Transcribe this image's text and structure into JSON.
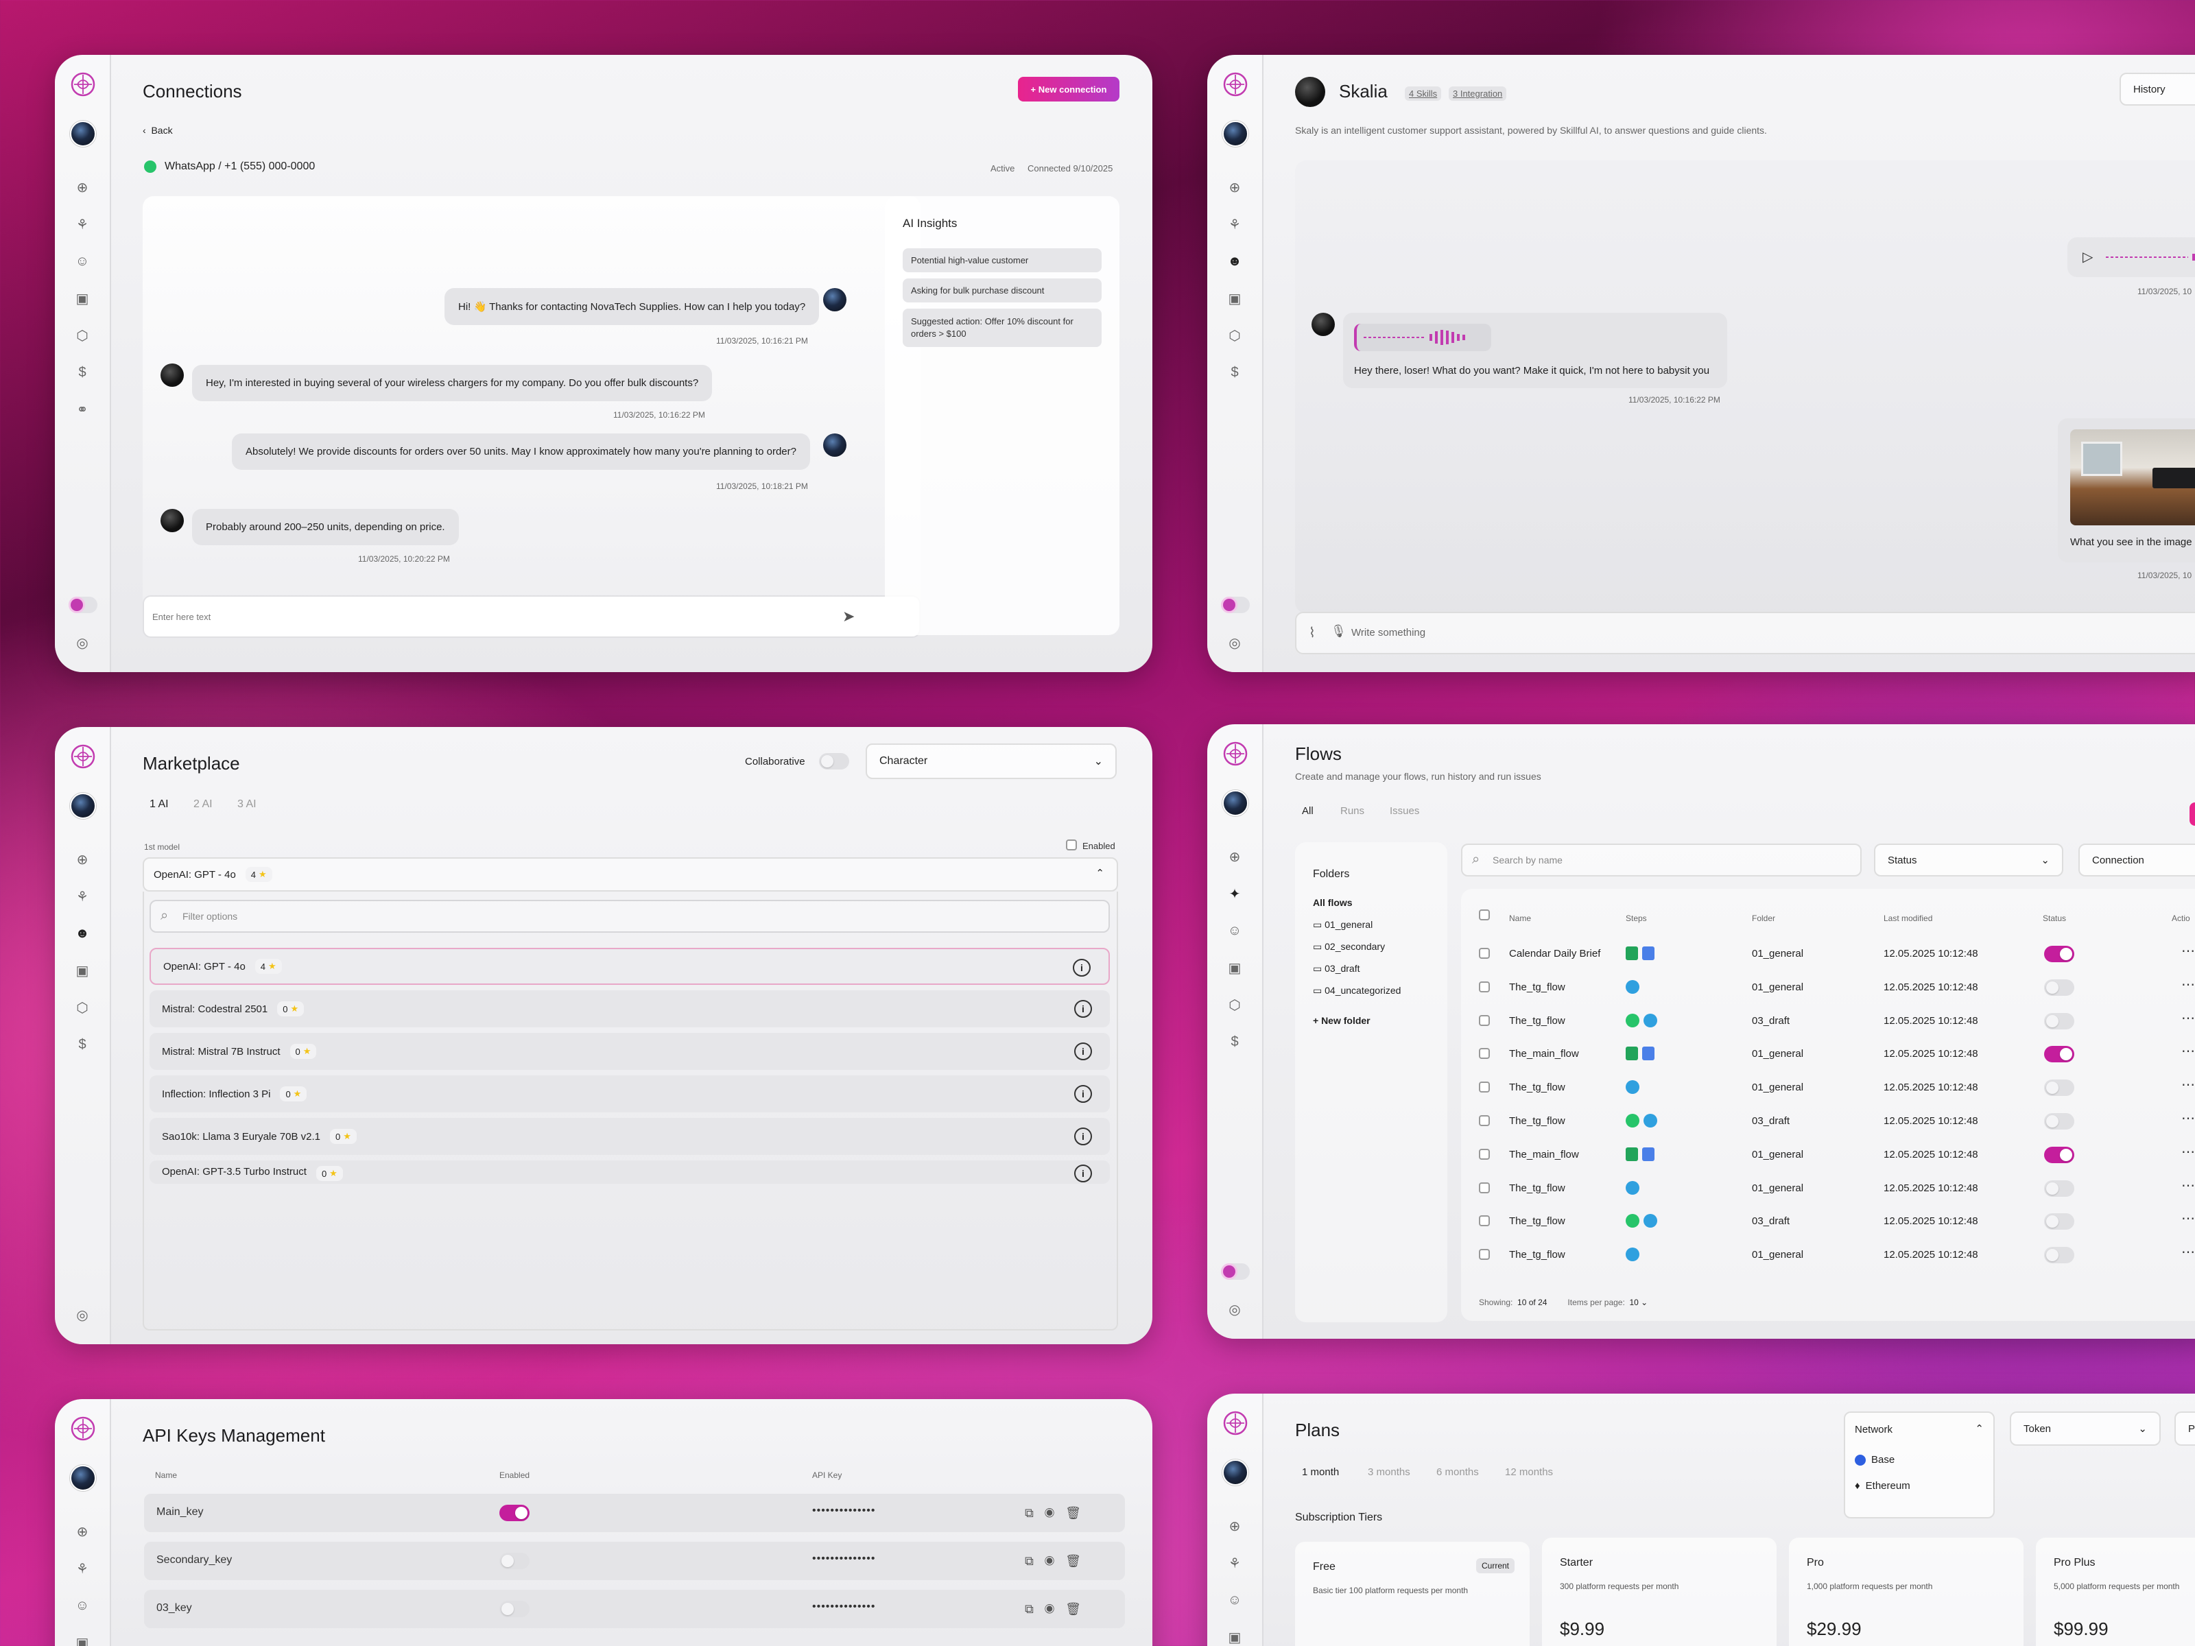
{
  "connections": {
    "title": "Connections",
    "new_button": "+ New connection",
    "back": "Back",
    "channel": "WhatsApp / +1 (555) 000-0000",
    "status": "Active",
    "connected": "Connected 9/10/2025",
    "messages": [
      {
        "text": "Hi! 👋 Thanks for contacting NovaTech Supplies. How can I help you today?",
        "time": "11/03/2025, 10:16:21 PM"
      },
      {
        "text": "Hey, I'm interested in buying several of your wireless chargers for my company. Do you offer bulk discounts?",
        "time": "11/03/2025, 10:16:22 PM"
      },
      {
        "text": "Absolutely! We provide discounts for orders over 50 units. May I know approximately how many you're planning to order?",
        "time": "11/03/2025, 10:18:21 PM"
      },
      {
        "text": "Probably around 200–250 units, depending on price.",
        "time": "11/03/2025, 10:20:22 PM"
      }
    ],
    "input_placeholder": "Enter here text",
    "insights": {
      "title": "AI Insights",
      "items": [
        "Potential high-value customer",
        "Asking for bulk purchase discount",
        "Suggested action: Offer 10% discount for orders > $100"
      ]
    }
  },
  "skalia": {
    "name": "Skalia",
    "skills": "4 Skills",
    "integration": "3 Integration",
    "history": "History",
    "description": "Skaly is an intelligent customer support assistant, powered by Skillful AI, to answer questions and guide clients.",
    "time1": "11/03/2025, 10",
    "reply": "Hey there, loser! What do you want? Make it quick, I'm not here to babysit you",
    "reply_time": "11/03/2025, 10:16:22 PM",
    "image_caption": "What you see in the image",
    "time2": "11/03/2025, 10",
    "input_placeholder": "Write something"
  },
  "marketplace": {
    "title": "Marketplace",
    "collaborative": "Collaborative",
    "character": "Character",
    "tabs": [
      "1 AI",
      "2 AI",
      "3 AI"
    ],
    "model_label": "1st model",
    "enabled": "Enabled",
    "selected": "OpenAI: GPT - 4o",
    "selected_rating": "4",
    "filter_placeholder": "Filter options",
    "options": [
      {
        "name": "OpenAI: GPT - 4o",
        "rating": "4"
      },
      {
        "name": "Mistral: Codestral 2501",
        "rating": "0"
      },
      {
        "name": "Mistral: Mistral 7B Instruct",
        "rating": "0"
      },
      {
        "name": "Inflection: Inflection 3 Pi",
        "rating": "0"
      },
      {
        "name": "Sao10k: Llama 3 Euryale 70B v2.1",
        "rating": "0"
      },
      {
        "name": "OpenAI: GPT-3.5 Turbo Instruct",
        "rating": "0"
      }
    ]
  },
  "flows": {
    "title": "Flows",
    "subtitle": "Create and manage your flows, run history and run issues",
    "tabs": [
      "All",
      "Runs",
      "Issues"
    ],
    "folders_title": "Folders",
    "all_flows": "All flows",
    "folders": [
      "01_general",
      "02_secondary",
      "03_draft",
      "04_uncategorized"
    ],
    "new_folder": "+ New folder",
    "search_placeholder": "Search by name",
    "status_filter": "Status",
    "connection_filter": "Connection",
    "columns": [
      "Name",
      "Steps",
      "Folder",
      "Last modified",
      "Status",
      "Actio"
    ],
    "rows": [
      {
        "name": "Calendar Daily Brief",
        "steps": [
          "sheet",
          "doc"
        ],
        "folder": "01_general",
        "modified": "12.05.2025 10:12:48",
        "on": true
      },
      {
        "name": "The_tg_flow",
        "steps": [
          "tg"
        ],
        "folder": "01_general",
        "modified": "12.05.2025 10:12:48",
        "on": false
      },
      {
        "name": "The_tg_flow",
        "steps": [
          "wa",
          "tg"
        ],
        "folder": "03_draft",
        "modified": "12.05.2025 10:12:48",
        "on": false
      },
      {
        "name": "The_main_flow",
        "steps": [
          "sheet",
          "doc"
        ],
        "folder": "01_general",
        "modified": "12.05.2025 10:12:48",
        "on": true
      },
      {
        "name": "The_tg_flow",
        "steps": [
          "tg"
        ],
        "folder": "01_general",
        "modified": "12.05.2025 10:12:48",
        "on": false
      },
      {
        "name": "The_tg_flow",
        "steps": [
          "wa",
          "tg"
        ],
        "folder": "03_draft",
        "modified": "12.05.2025 10:12:48",
        "on": false
      },
      {
        "name": "The_main_flow",
        "steps": [
          "sheet",
          "doc"
        ],
        "folder": "01_general",
        "modified": "12.05.2025 10:12:48",
        "on": true
      },
      {
        "name": "The_tg_flow",
        "steps": [
          "tg"
        ],
        "folder": "01_general",
        "modified": "12.05.2025 10:12:48",
        "on": false
      },
      {
        "name": "The_tg_flow",
        "steps": [
          "wa",
          "tg"
        ],
        "folder": "03_draft",
        "modified": "12.05.2025 10:12:48",
        "on": false
      },
      {
        "name": "The_tg_flow",
        "steps": [
          "tg"
        ],
        "folder": "01_general",
        "modified": "12.05.2025 10:12:48",
        "on": false
      }
    ],
    "showing_label": "Showing:",
    "showing_value": "10 of 24",
    "per_page_label": "Items per page:",
    "per_page_value": "10"
  },
  "apikeys": {
    "title": "API Keys Management",
    "columns": [
      "Name",
      "Enabled",
      "API Key"
    ],
    "rows": [
      {
        "name": "Main_key",
        "on": true,
        "key": "••••••••••••••"
      },
      {
        "name": "Secondary_key",
        "on": false,
        "key": "••••••••••••••"
      },
      {
        "name": "03_key",
        "on": false,
        "key": "••••••••••••••"
      }
    ]
  },
  "plans": {
    "title": "Plans",
    "tabs": [
      "1 month",
      "3 months",
      "6 months",
      "12 months"
    ],
    "network": "Network",
    "network_options": [
      "Base",
      "Ethereum"
    ],
    "token": "Token",
    "pay_short": "Pu",
    "tiers_title": "Subscription Tiers",
    "tiers": [
      {
        "name": "Free",
        "badge": "Current",
        "desc": "Basic tier 100 platform requests per month",
        "price": ""
      },
      {
        "name": "Starter",
        "badge": "",
        "desc": "300 platform requests per month",
        "price": "$9.99"
      },
      {
        "name": "Pro",
        "badge": "",
        "desc": "1,000 platform requests per month",
        "price": "$29.99"
      },
      {
        "name": "Pro Plus",
        "badge": "",
        "desc": "5,000 platform requests per month",
        "price": "$99.99"
      }
    ]
  }
}
